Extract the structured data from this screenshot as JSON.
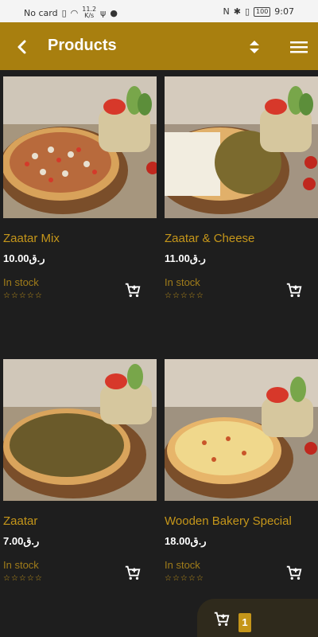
{
  "status_bar": {
    "carrier": "No card",
    "speed_top": "11.2",
    "speed_unit": "K/s",
    "battery": "100",
    "time": "9:07"
  },
  "appbar": {
    "title": "Products",
    "color": "#a87f0f"
  },
  "products": [
    {
      "name": "Zaatar Mix",
      "price": "10.00ر.ق",
      "stock": "In stock",
      "rating_stars": "☆☆☆☆☆"
    },
    {
      "name": "Zaatar & Cheese",
      "price": "11.00ر.ق",
      "stock": "In stock",
      "rating_stars": "☆☆☆☆☆"
    },
    {
      "name": "Zaatar",
      "price": "7.00ر.ق",
      "stock": "In stock",
      "rating_stars": "☆☆☆☆☆"
    },
    {
      "name": "Wooden Bakery Special",
      "price": "18.00ر.ق",
      "stock": "In stock",
      "rating_stars": "☆☆☆☆☆"
    }
  ],
  "cart": {
    "count": "1"
  },
  "colors": {
    "accent": "#c5961a",
    "background": "#1e1e1e"
  }
}
